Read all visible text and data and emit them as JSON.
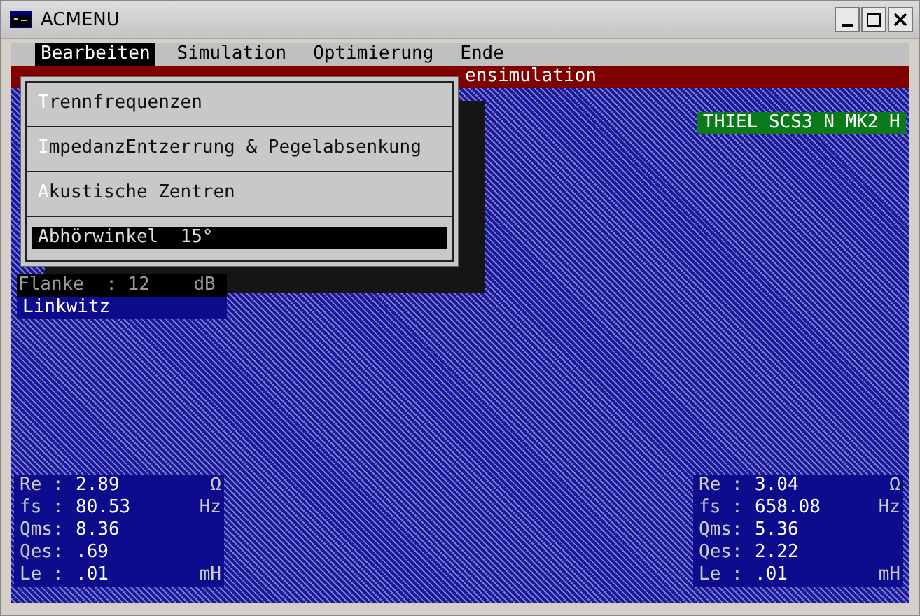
{
  "window": {
    "title": "ACMENU"
  },
  "menu_bar": [
    {
      "label": "Bearbeiten",
      "selected": true
    },
    {
      "label": "Simulation",
      "selected": false
    },
    {
      "label": "Optimierung",
      "selected": false
    },
    {
      "label": "Ende",
      "selected": false
    }
  ],
  "header_bar": {
    "text": "ensimulation"
  },
  "dropdown": {
    "items": [
      {
        "label": "Trennfrequenzen",
        "hotkey": true,
        "selected": false
      },
      {
        "label": "ImpedanzEntzerrung & Pegelabsenkung",
        "hotkey": true,
        "selected": false
      },
      {
        "label": "Akustische Zentren",
        "hotkey": true,
        "selected": false
      },
      {
        "label": "Abhörwinkel  15°",
        "hotkey": false,
        "selected": true
      }
    ]
  },
  "filter": {
    "slope": "Flanke  : 12    dB",
    "type": "Linkwitz"
  },
  "speaker": "THIEL SCS3 N MK2 H",
  "params_left": [
    {
      "label": "Re :",
      "value": "2.89",
      "unit": "Ω"
    },
    {
      "label": "fs :",
      "value": "80.53",
      "unit": "Hz"
    },
    {
      "label": "Qms:",
      "value": "8.36"
    },
    {
      "label": "Qes:",
      "value": ".69"
    },
    {
      "label": "Le :",
      "value": ".01",
      "unit": "mH"
    }
  ],
  "params_right": [
    {
      "label": "Re :",
      "value": "3.04",
      "unit": "Ω"
    },
    {
      "label": "fs :",
      "value": "658.08",
      "unit": "Hz"
    },
    {
      "label": "Qms:",
      "value": "5.36"
    },
    {
      "label": "Qes:",
      "value": "2.22"
    },
    {
      "label": "Le :",
      "value": ".01",
      "unit": "mH"
    }
  ]
}
